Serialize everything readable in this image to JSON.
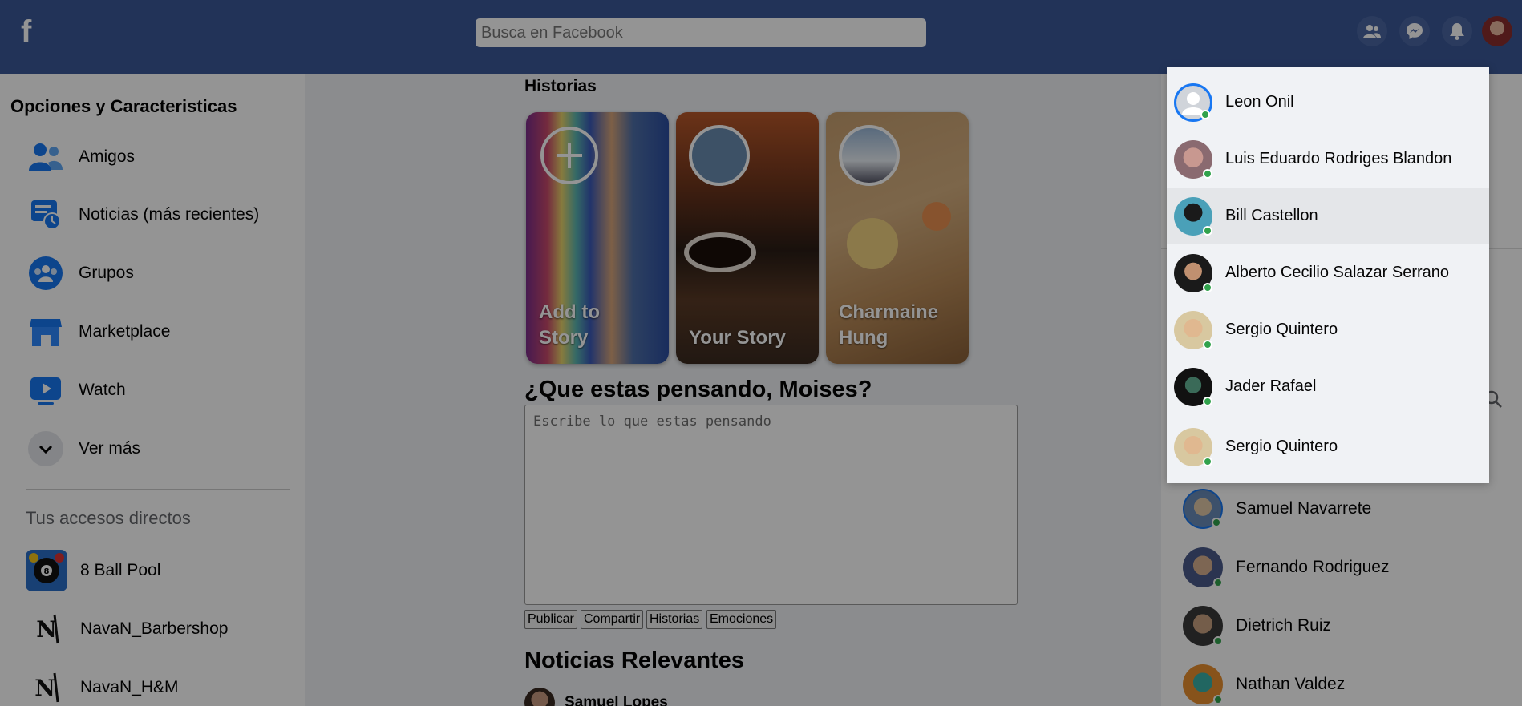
{
  "header": {
    "logo": "f",
    "search_placeholder": "Busca en Facebook",
    "icons": [
      "friends-icon",
      "messenger-icon",
      "bell-icon"
    ]
  },
  "left": {
    "title": "Opciones y Caracteristicas",
    "nav": [
      {
        "label": "Amigos",
        "icon": "friends-icon"
      },
      {
        "label": "Noticias (más recientes)",
        "icon": "news-clock-icon"
      },
      {
        "label": "Grupos",
        "icon": "groups-icon"
      },
      {
        "label": "Marketplace",
        "icon": "store-icon"
      },
      {
        "label": "Watch",
        "icon": "play-icon"
      },
      {
        "label": "Ver más",
        "icon": "chevron-down-icon"
      }
    ],
    "shortcuts_title": "Tus accesos directos",
    "shortcuts": [
      {
        "label": "8 Ball Pool"
      },
      {
        "label": "NavaN_Barbershop"
      },
      {
        "label": "NavaN_H&M"
      }
    ]
  },
  "center": {
    "stories_title": "Historias",
    "stories": [
      {
        "label": "Add to Story"
      },
      {
        "label": "Your Story"
      },
      {
        "label": "Charmaine Hung"
      }
    ],
    "prompt": "¿Que estas pensando, Moises?",
    "post_placeholder": "Escribe lo que estas pensando",
    "buttons": [
      "Publicar",
      "Compartir",
      "Historias",
      "Emociones"
    ],
    "news_title": "Noticias Relevantes",
    "news_author": "Samuel Lopes"
  },
  "contacts": [
    {
      "name": "Samuel Navarrete"
    },
    {
      "name": "Fernando Rodriguez"
    },
    {
      "name": "Dietrich Ruiz"
    },
    {
      "name": "Nathan Valdez"
    }
  ],
  "dropdown": [
    {
      "name": "Leon Onil"
    },
    {
      "name": "Luis Eduardo Rodriges Blandon"
    },
    {
      "name": "Bill Castellon"
    },
    {
      "name": "Alberto Cecilio Salazar Serrano"
    },
    {
      "name": "Sergio Quintero"
    },
    {
      "name": "Jader Rafael"
    },
    {
      "name": "Sergio Quintero"
    }
  ],
  "colors": {
    "header": "#3b5998",
    "online": "#31a24c",
    "overlay": "rgba(0,0,0,0.42)"
  }
}
